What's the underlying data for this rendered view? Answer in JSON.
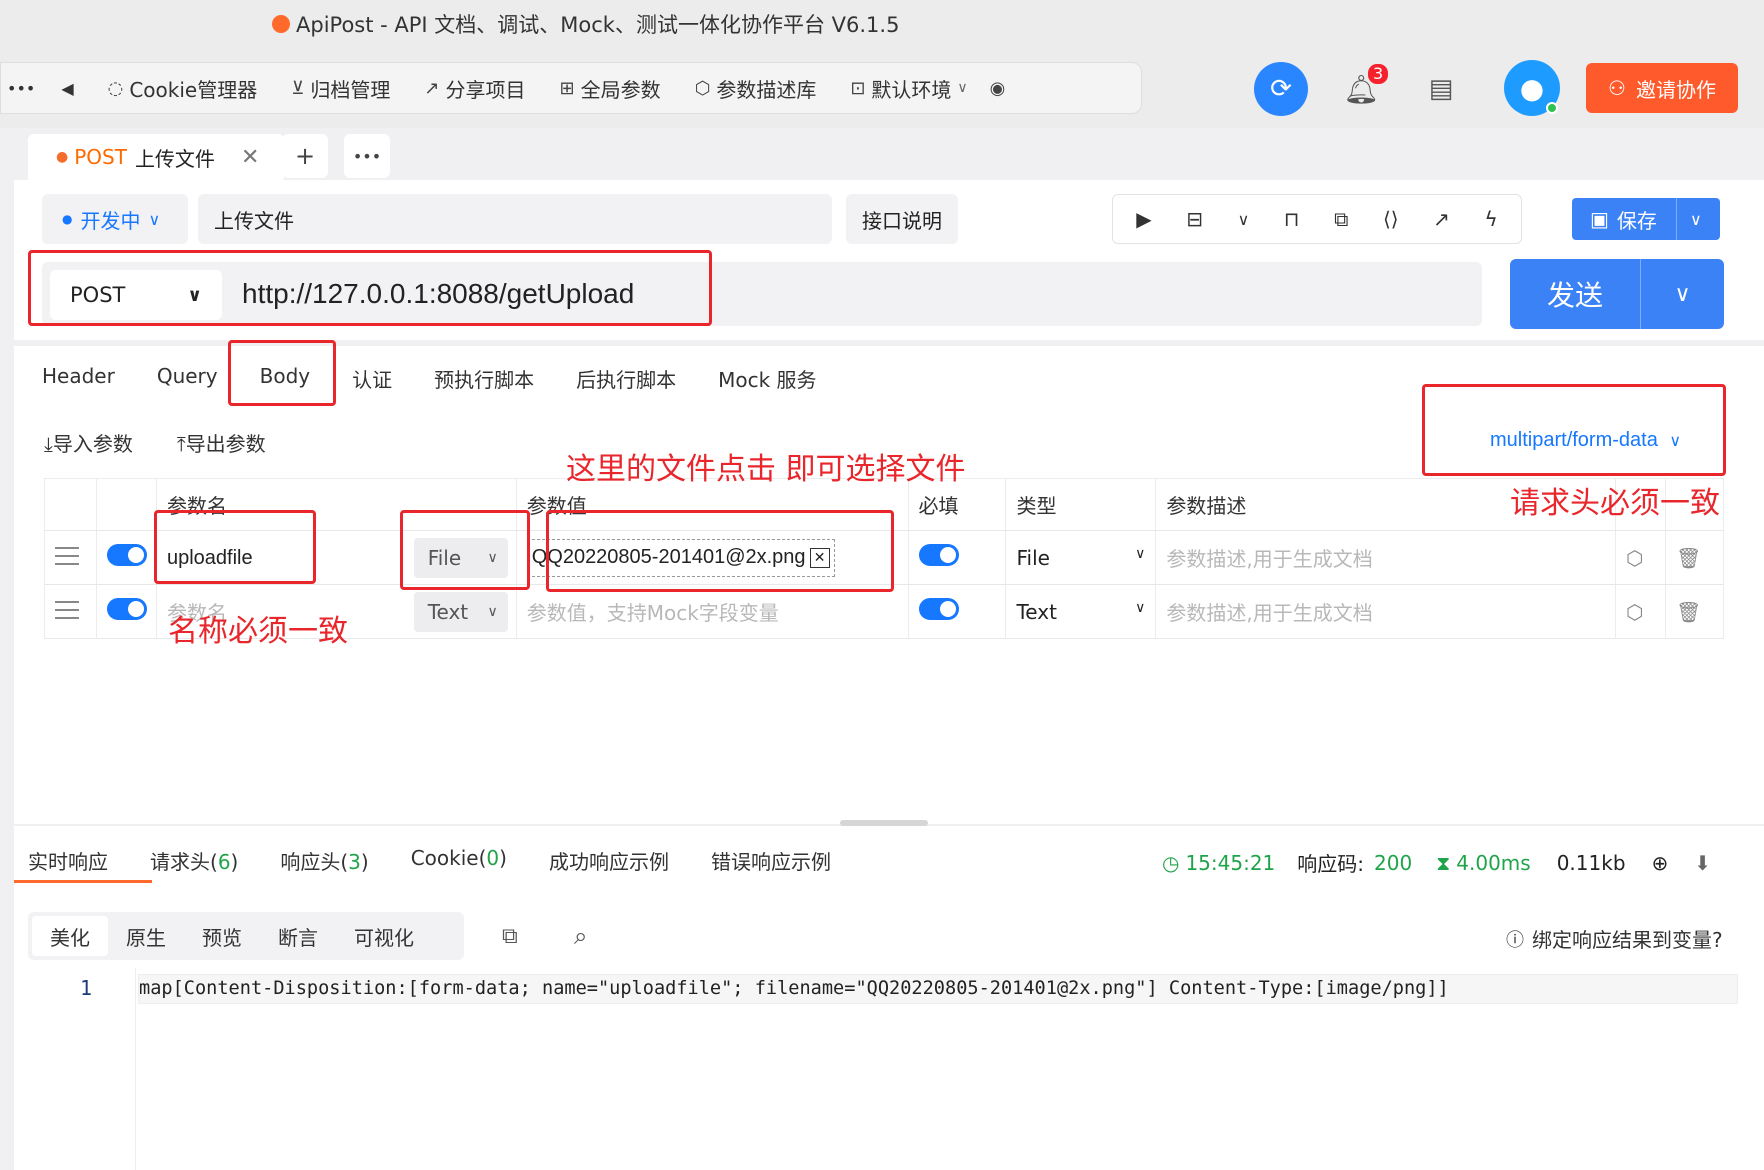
{
  "window": {
    "title": "ApiPost - API 文档、调试、Mock、测试一体化协作平台 V6.1.5"
  },
  "toolbar": {
    "more": "•••",
    "back": "◀",
    "items": [
      {
        "icon": "cookie-icon",
        "label": "Cookie管理器"
      },
      {
        "icon": "archive-icon",
        "label": "归档管理"
      },
      {
        "icon": "share-icon",
        "label": "分享项目"
      },
      {
        "icon": "global-params-icon",
        "label": "全局参数"
      },
      {
        "icon": "cube-icon",
        "label": "参数描述库"
      },
      {
        "icon": "env-icon",
        "label": "默认环境"
      }
    ],
    "notification_count": "3",
    "invite_label": "邀请协作"
  },
  "request_tab": {
    "method": "POST",
    "name": "上传文件",
    "add": "+",
    "more": "•••"
  },
  "request": {
    "status": "开发中",
    "name": "上传文件",
    "doc_button": "接口说明",
    "save_label": "保存",
    "method": "POST",
    "url": "http://127.0.0.1:8088/getUpload",
    "send_label": "发送"
  },
  "req_tabs": [
    "Header",
    "Query",
    "Body",
    "认证",
    "预执行脚本",
    "后执行脚本",
    "Mock 服务"
  ],
  "body": {
    "import_label": "导入参数",
    "export_label": "导出参数",
    "content_type": "multipart/form-data",
    "columns": [
      "参数名",
      "参数值",
      "必填",
      "类型",
      "参数描述"
    ],
    "rows": [
      {
        "name": "uploadfile",
        "value_type": "File",
        "value": "QQ20220805-201401@2x.png",
        "type": "File",
        "desc_placeholder": "参数描述,用于生成文档"
      },
      {
        "name_placeholder": "参数名",
        "value_type": "Text",
        "value_placeholder": "参数值，支持Mock字段变量",
        "type": "Text",
        "desc_placeholder": "参数描述,用于生成文档"
      }
    ]
  },
  "annotations": {
    "file_hint": "这里的文件点击 即可选择文件",
    "header_hint": "请求头必须一致",
    "name_hint": "名称必须一致"
  },
  "response": {
    "tabs": [
      {
        "label": "实时响应",
        "count": ""
      },
      {
        "label": "请求头",
        "count": "6"
      },
      {
        "label": "响应头",
        "count": "3"
      },
      {
        "label": "Cookie",
        "count": "0"
      },
      {
        "label": "成功响应示例",
        "count": ""
      },
      {
        "label": "错误响应示例",
        "count": ""
      }
    ],
    "time": "15:45:21",
    "code_label": "响应码:",
    "code": "200",
    "duration": "4.00ms",
    "size": "0.11kb",
    "view_tabs": [
      "美化",
      "原生",
      "预览",
      "断言",
      "可视化"
    ],
    "bind_label": "绑定响应结果到变量?",
    "line_number": "1",
    "body_text": "map[Content-Disposition:[form-data; name=\"uploadfile\"; filename=\"QQ20220805-201401@2x.png\"] Content-Type:[image/png]]"
  },
  "colors": {
    "accent": "#3b82f6",
    "annotation": "#e8262b",
    "invite": "#ff5a2c",
    "success": "#20a44a"
  }
}
